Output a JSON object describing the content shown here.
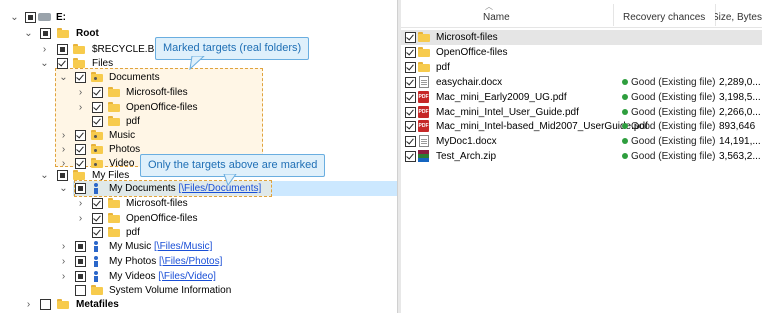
{
  "tree": {
    "drive_label": "E:",
    "root": "Root",
    "recycle": "$RECYCLE.BIN",
    "files": "Files",
    "documents": "Documents",
    "microsoft_files": "Microsoft-files",
    "openoffice_files": "OpenOffice-files",
    "pdf": "pdf",
    "music": "Music",
    "photos": "Photos",
    "video": "Video",
    "my_files": "My Files",
    "my_documents": "My Documents",
    "my_documents_link": "[\\Files/Documents]",
    "my_music": "My Music",
    "my_music_link": "[\\Files/Music]",
    "my_photos": "My Photos",
    "my_photos_link": "[\\Files/Photos]",
    "my_videos": "My Videos",
    "my_videos_link": "[\\Files/Video]",
    "system_volume": "System Volume Information",
    "metafiles": "Metafiles"
  },
  "callouts": {
    "marked_targets": "Marked targets (real folders)",
    "only_targets": "Only the targets above are marked"
  },
  "list": {
    "columns": {
      "name": "Name",
      "recovery": "Recovery chances",
      "size": "Size, Bytes"
    },
    "rows": [
      {
        "name": "Microsoft-files",
        "type": "folder",
        "status": "",
        "size": "",
        "selected": true
      },
      {
        "name": "OpenOffice-files",
        "type": "folder",
        "status": "",
        "size": ""
      },
      {
        "name": "pdf",
        "type": "folder",
        "status": "",
        "size": ""
      },
      {
        "name": "easychair.docx",
        "type": "doc",
        "status": "Good (Existing file)",
        "size": "2,289,0..."
      },
      {
        "name": "Mac_mini_Early2009_UG.pdf",
        "type": "pdf",
        "status": "Good (Existing file)",
        "size": "3,198,5..."
      },
      {
        "name": "Mac_mini_Intel_User_Guide.pdf",
        "type": "pdf",
        "status": "Good (Existing file)",
        "size": "2,266,0..."
      },
      {
        "name": "Mac_mini_Intel-based_Mid2007_UserGuide.pdf",
        "type": "pdf",
        "status": "Good (Existing file)",
        "size": "893,646"
      },
      {
        "name": "MyDoc1.docx",
        "type": "doc",
        "status": "Good (Existing file)",
        "size": "14,191,..."
      },
      {
        "name": "Test_Arch.zip",
        "type": "zip",
        "status": "Good (Existing file)",
        "size": "3,563,2..."
      }
    ]
  },
  "colors": {
    "accent_link": "#1a4fd6",
    "callout_border": "#6aaee0",
    "marked_border": "#e0a33c",
    "good_status": "#2e9e3e",
    "selection": "#cce8ff"
  }
}
